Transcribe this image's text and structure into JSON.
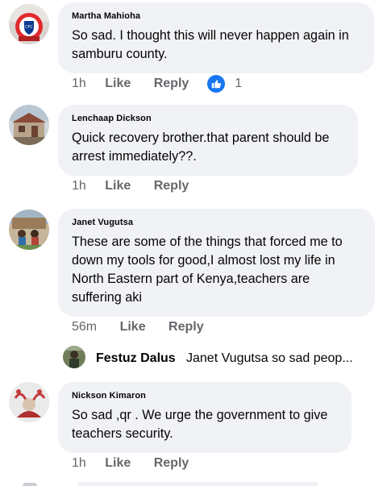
{
  "comments": [
    {
      "author": "Martha Mahioha",
      "text": "So sad. I thought this will never happen again in samburu county.",
      "time": "1h",
      "like_label": "Like",
      "reply_label": "Reply",
      "reactions": "1"
    },
    {
      "author": "Lenchaap Dickson",
      "text": "Quick recovery brother.that parent should be arrest immediately??.",
      "time": "1h",
      "like_label": "Like",
      "reply_label": "Reply"
    },
    {
      "author": "Janet Vugutsa",
      "text": "These are some of the things that forced me to down my tools for good,I almost lost my life in North Eastern part of Kenya,teachers are suffering aki",
      "time": "56m",
      "like_label": "Like",
      "reply_label": "Reply"
    },
    {
      "author": "Nickson Kimaron",
      "text": "So sad ,qr . We urge the government to give teachers security.",
      "time": "1h",
      "like_label": "Like",
      "reply_label": "Reply"
    }
  ],
  "reply_preview": {
    "author": "Festuz Dalus",
    "text": "Janet Vugutsa so sad peop..."
  },
  "icons": {
    "reaction": "like-thumb-icon"
  },
  "colors": {
    "bubble": "#f0f2f5",
    "secondary_text": "#65676b",
    "like_blue": "#1877f2"
  }
}
